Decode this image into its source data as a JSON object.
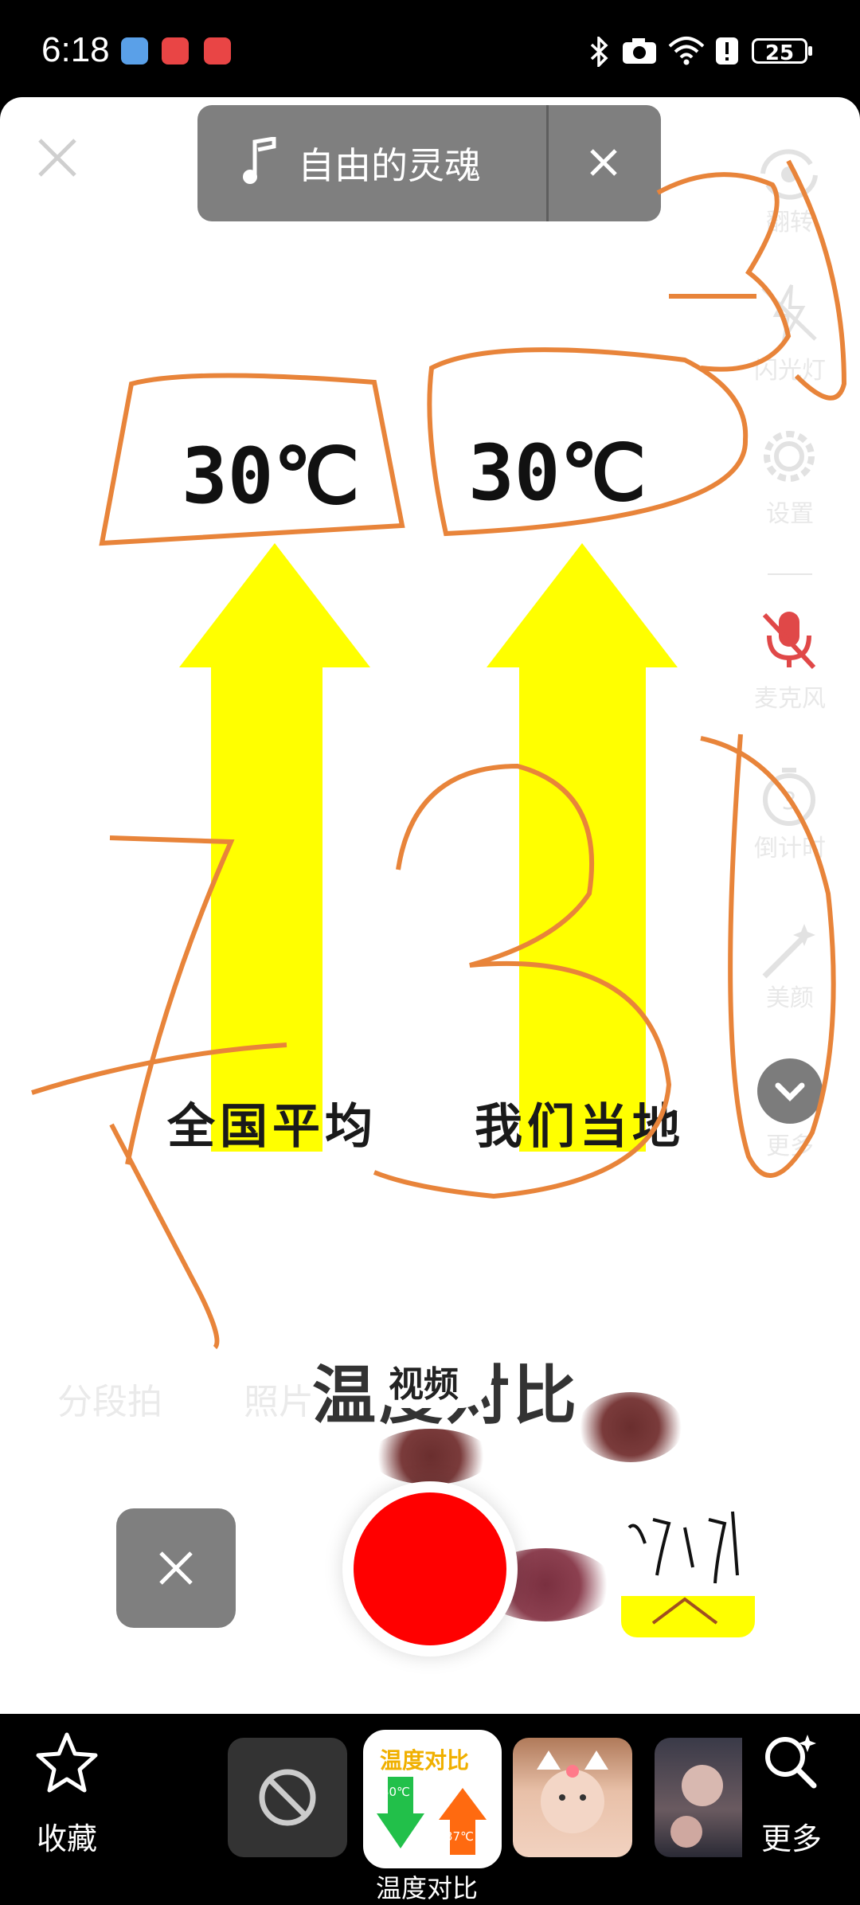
{
  "status_bar": {
    "time": "6:18",
    "battery": "25"
  },
  "music": {
    "title": "自由的灵魂"
  },
  "side_menu": {
    "flip": "翻转",
    "flash": "闪光灯",
    "settings": "设置",
    "microphone": "麦克风",
    "timer": "倒计时",
    "beauty": "美颜",
    "more": "更多"
  },
  "content": {
    "left_temp": "30℃",
    "right_temp": "30℃",
    "left_label": "全国平均",
    "right_label": "我们当地",
    "title": "温度对比",
    "handwritten": [
      "31",
      "31",
      "731"
    ]
  },
  "modes": {
    "segment": "分段拍",
    "photo": "照片",
    "video": "视频"
  },
  "effects": {
    "favorites": "收藏",
    "more": "更多",
    "selected_label": "温度对比",
    "card_title": "温度对比",
    "card_green": "30℃",
    "card_orange": "37℃"
  }
}
